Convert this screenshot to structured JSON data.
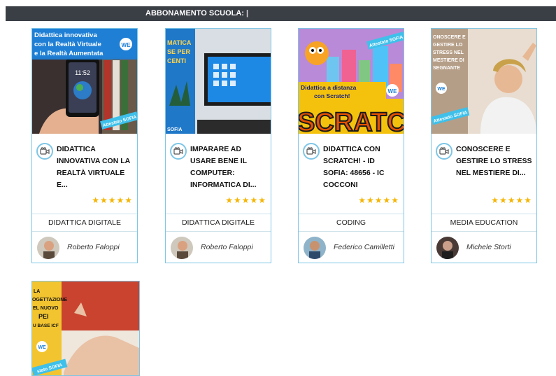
{
  "header": {
    "title": "ABBONAMENTO SCUOLA:"
  },
  "colors": {
    "accent": "#7ec6e6",
    "star": "#f5b400",
    "topbar": "#3a3e45"
  },
  "courses": [
    {
      "thumb_text": [
        "Didattica innovativa",
        "con la Realtà Virtuale",
        "e la Realtà Aumentata"
      ],
      "thumb_badge": "Attestato SOFIA",
      "title": "DIDATTICA INNOVATIVA CON LA REALTÀ VIRTUALE E...",
      "rating": "★★★★★",
      "category": "DIDATTICA DIGITALE",
      "author": "Roberto Faloppi"
    },
    {
      "thumb_text": [
        "MATICA",
        "SE PER",
        "CENTI"
      ],
      "thumb_badge": "SOFIA",
      "title": "IMPARARE AD USARE BENE IL COMPUTER: INFORMATICA DI...",
      "rating": "★★★★★",
      "category": "DIDATTICA DIGITALE",
      "author": "Roberto Faloppi"
    },
    {
      "thumb_text": [
        "Didattica a distanza",
        "con Scratch!"
      ],
      "thumb_badge": "Attestato SOFIA",
      "thumb_big": "SCRATC",
      "title": "DIDATTICA CON SCRATCH! - ID SOFIA: 48656 - IC COCCONI",
      "rating": "★★★★★",
      "category": "CODING",
      "author": "Federico Camilletti"
    },
    {
      "thumb_text": [
        "ONOSCERE E",
        "GESTIRE LO",
        "STRESS NEL",
        "MESTIERE DI",
        "SEGNANTE"
      ],
      "thumb_badge": "Attestato SOFIA",
      "title": "CONOSCERE E GESTIRE LO STRESS NEL MESTIERE DI...",
      "rating": "★★★★★",
      "category": "MEDIA EDUCATION",
      "author": "Michele Storti"
    }
  ],
  "course5": {
    "thumb_text": [
      "LA",
      "OGETTAZIONE",
      "EL NUOVO",
      "PEI",
      "U BASE ICF"
    ],
    "thumb_badge": "stato SOFIA"
  },
  "brand": "WE"
}
